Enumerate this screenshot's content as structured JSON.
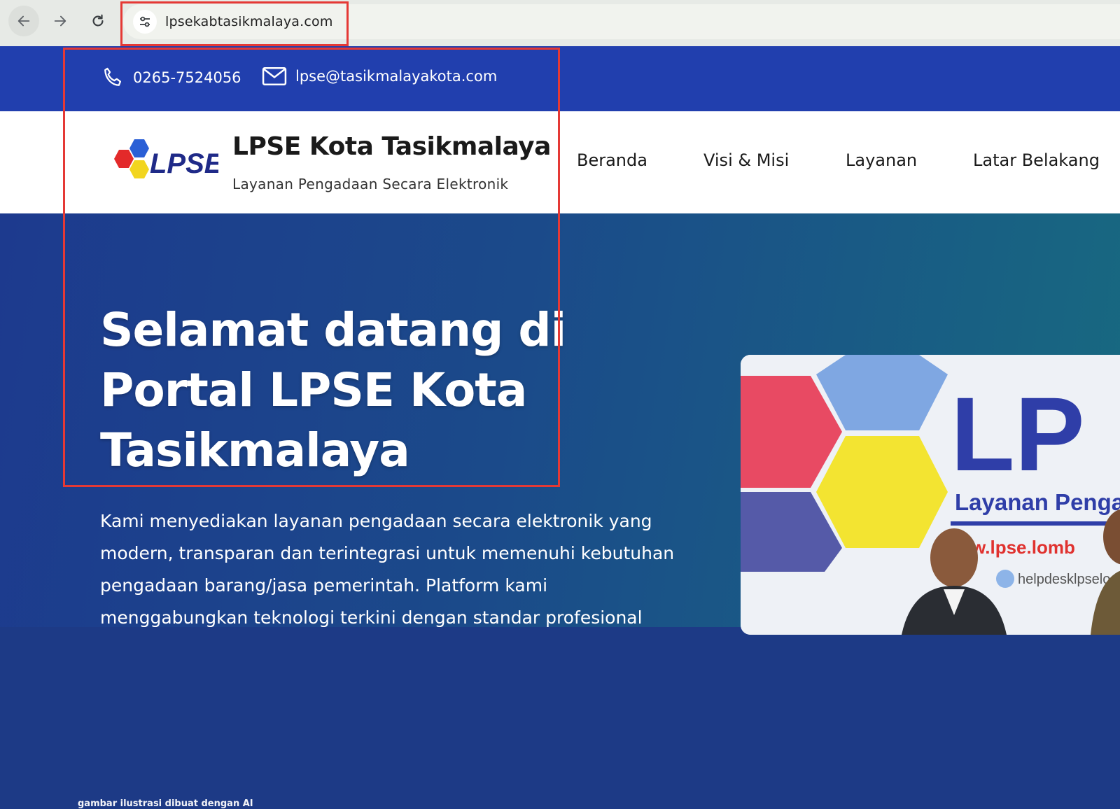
{
  "browser": {
    "url": "lpsekabtasikmalaya.com",
    "icons": {
      "back": "arrow-left-icon",
      "forward": "arrow-right-icon",
      "reload": "reload-icon",
      "site_info": "tune-icon"
    }
  },
  "topbar": {
    "phone": "0265-7524056",
    "email": "lpse@tasikmalayakota.com",
    "icons": {
      "phone": "phone-icon",
      "email": "mail-icon"
    }
  },
  "header": {
    "logo_text": "LPSE",
    "title": "LPSE Kota Tasikmalaya",
    "subtitle": "Layanan Pengadaan Secara Elektronik",
    "menu": [
      {
        "label": "Beranda"
      },
      {
        "label": "Visi & Misi"
      },
      {
        "label": "Layanan"
      },
      {
        "label": "Latar Belakang"
      }
    ]
  },
  "hero": {
    "title": "Selamat datang di Portal LPSE Kota Tasikmalaya",
    "description": "Kami menyediakan layanan pengadaan secara elektronik yang modern, transparan dan terintegrasi untuk memenuhi kebutuhan pengadaan barang/jasa pemerintah. Platform kami menggabungkan teknologi terkini dengan standar profesional",
    "photo": {
      "banner_text_1": "LP",
      "banner_text_2": "Layanan Pengada",
      "banner_text_3": "w.lpse.lomb",
      "banner_text_4": "helpdesklpselo"
    }
  },
  "watermark": "gambar ilustrasi dibuat dengan AI",
  "colors": {
    "topbar": "#213fae",
    "hero_start": "#1d3a8e",
    "hero_end": "#176a80",
    "highlight": "#e53935"
  }
}
